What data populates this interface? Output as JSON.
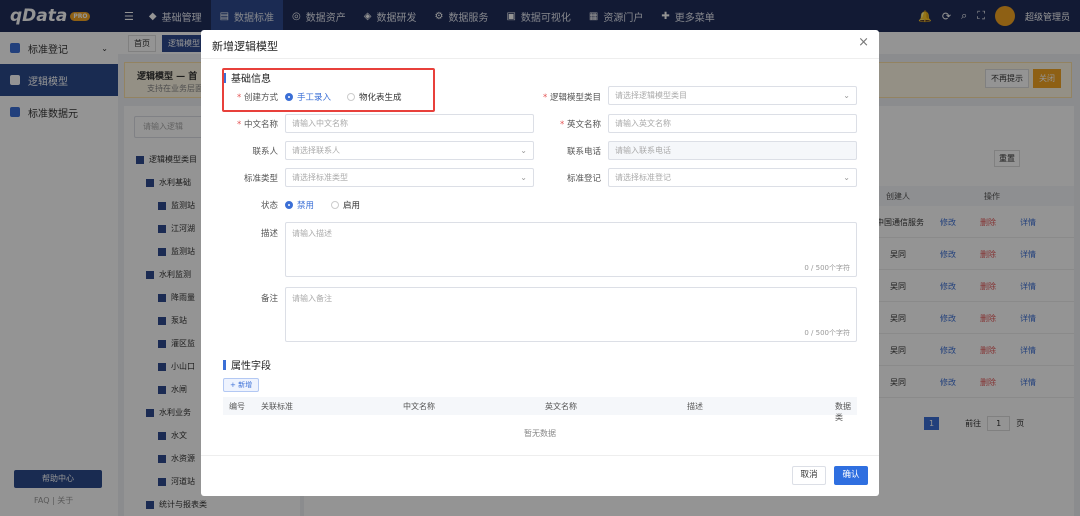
{
  "app": {
    "logo": "qData",
    "logo_badge": "PRO"
  },
  "nav": [
    "基础管理",
    "数据标准",
    "数据资产",
    "数据研发",
    "数据服务",
    "数据可视化",
    "资源门户",
    "更多菜单"
  ],
  "user": {
    "name": "超级管理员"
  },
  "sidebar": {
    "items": [
      "标准登记",
      "逻辑模型",
      "标准数据元"
    ],
    "help": "帮助中心",
    "faq": "FAQ",
    "about": "关于"
  },
  "crumbs": [
    "首页",
    "逻辑模型"
  ],
  "notice": {
    "title": "逻辑模型 — 首",
    "desc": "支持在业务层面",
    "btn_hide": "不再提示",
    "btn_close": "关闭"
  },
  "tree": {
    "search_placeholder": "请输入逻辑",
    "nodes": [
      "逻辑模型类目",
      "水利基础",
      "监测站",
      "江河湖",
      "监测站",
      "水利监测",
      "降雨量",
      "泵站",
      "灌区监",
      "小山口",
      "水闸",
      "水利业务",
      "水文",
      "水资源",
      "河道站",
      "统计与报表类"
    ]
  },
  "list": {
    "headers": [
      "创建人",
      "操作"
    ],
    "rows": [
      {
        "creator": "中国通信服务"
      },
      {
        "creator": "吴同"
      },
      {
        "creator": "吴同"
      },
      {
        "creator": "吴同"
      },
      {
        "creator": "吴同"
      },
      {
        "creator": "吴同"
      }
    ],
    "ops": [
      "修改",
      "删除",
      "详情"
    ],
    "reset": "重置",
    "pagination": {
      "current": "1",
      "goto_label": "前往",
      "goto_value": "1",
      "page_unit": "页"
    }
  },
  "modal": {
    "title": "新增逻辑模型",
    "basic_section": "基础信息",
    "create_method_label": "创建方式",
    "create_options": [
      "手工录入",
      "物化表生成"
    ],
    "category_label": "逻辑模型类目",
    "category_placeholder": "请选择逻辑模型类目",
    "cn_name_label": "中文名称",
    "cn_name_placeholder": "请输入中文名称",
    "en_name_label": "英文名称",
    "en_name_placeholder": "请输入英文名称",
    "contact_label": "联系人",
    "contact_placeholder": "请选择联系人",
    "phone_label": "联系电话",
    "phone_placeholder": "请输入联系电话",
    "std_type_label": "标准类型",
    "std_type_placeholder": "请选择标准类型",
    "std_reg_label": "标准登记",
    "std_reg_placeholder": "请选择标准登记",
    "status_label": "状态",
    "status_options": [
      "禁用",
      "启用"
    ],
    "desc_label": "描述",
    "desc_placeholder": "请输入描述",
    "desc_count": "0 / 500个字符",
    "remark_label": "备注",
    "remark_placeholder": "请输入备注",
    "remark_count": "0 / 500个字符",
    "attr_section": "属性字段",
    "add_button": "+ 新增",
    "field_headers": [
      "编号",
      "关联标准",
      "中文名称",
      "英文名称",
      "描述",
      "数据类"
    ],
    "no_data": "暂无数据",
    "cancel": "取消",
    "confirm": "确认"
  }
}
